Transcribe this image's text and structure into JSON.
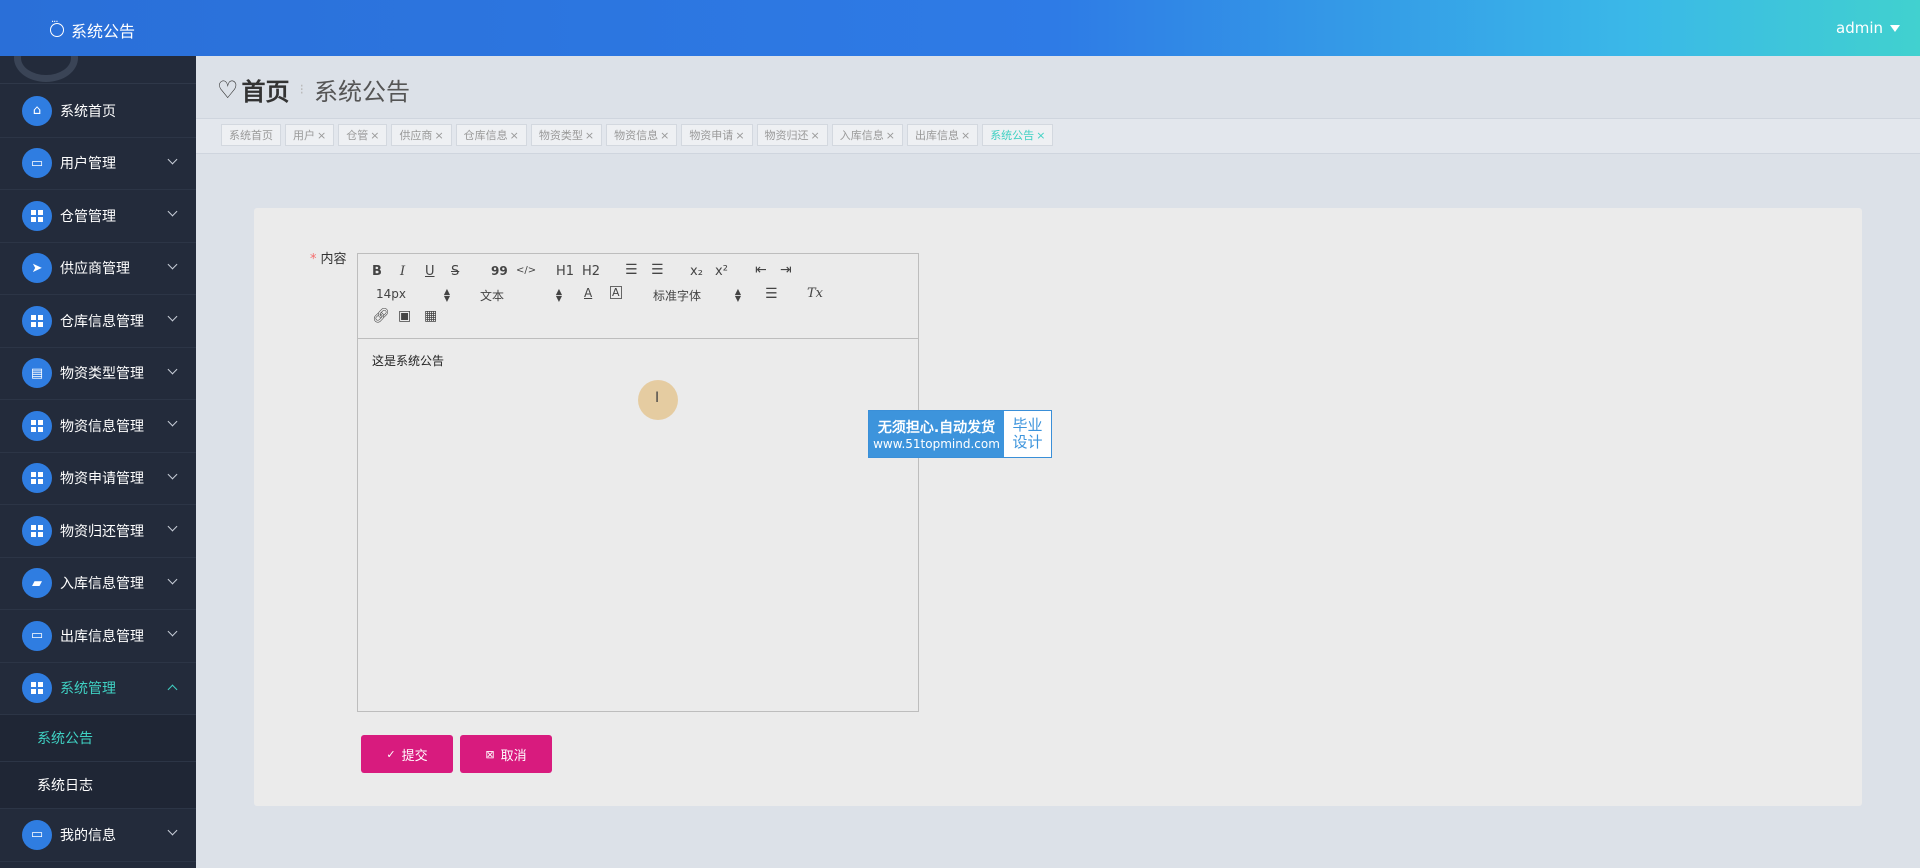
{
  "topbar": {
    "title": "系统公告",
    "user": "admin"
  },
  "sidebar": {
    "items": [
      {
        "label": "系统首页"
      },
      {
        "label": "用户管理"
      },
      {
        "label": "仓管管理"
      },
      {
        "label": "供应商管理"
      },
      {
        "label": "仓库信息管理"
      },
      {
        "label": "物资类型管理"
      },
      {
        "label": "物资信息管理"
      },
      {
        "label": "物资申请管理"
      },
      {
        "label": "物资归还管理"
      },
      {
        "label": "入库信息管理"
      },
      {
        "label": "出库信息管理"
      },
      {
        "label": "系统管理"
      },
      {
        "label": "我的信息"
      }
    ],
    "sub_items": [
      {
        "label": "系统公告"
      },
      {
        "label": "系统日志"
      }
    ]
  },
  "breadcrumb": {
    "home": "首页",
    "current": "系统公告"
  },
  "tabs": [
    {
      "label": "系统首页"
    },
    {
      "label": "用户"
    },
    {
      "label": "仓管"
    },
    {
      "label": "供应商"
    },
    {
      "label": "仓库信息"
    },
    {
      "label": "物资类型"
    },
    {
      "label": "物资信息"
    },
    {
      "label": "物资申请"
    },
    {
      "label": "物资归还"
    },
    {
      "label": "入库信息"
    },
    {
      "label": "出库信息"
    },
    {
      "label": "系统公告"
    }
  ],
  "tab_close": "×",
  "form": {
    "required_mark": "*",
    "content_label": "内容",
    "content_value": "这是系统公告"
  },
  "editor_toolbar": {
    "bold": "B",
    "italic": "I",
    "underline": "U",
    "strike": "S",
    "quote": "99",
    "code": "</>",
    "h1": "H1",
    "h2": "H2",
    "sub": "x₂",
    "sup": "x²",
    "size": "14px",
    "block": "文本",
    "font": "标准字体",
    "clean": "Tx"
  },
  "watermark": {
    "line1": "无须担心.自动发货",
    "line2": "www.51topmind.com",
    "right1": "毕业",
    "right2": "设计"
  },
  "buttons": {
    "submit": "提交",
    "cancel": "取消"
  },
  "colors": {
    "accent": "#3fd1c3",
    "primary": "#2f7de1",
    "button": "#d81b7e",
    "sidebar": "#232b3b"
  }
}
